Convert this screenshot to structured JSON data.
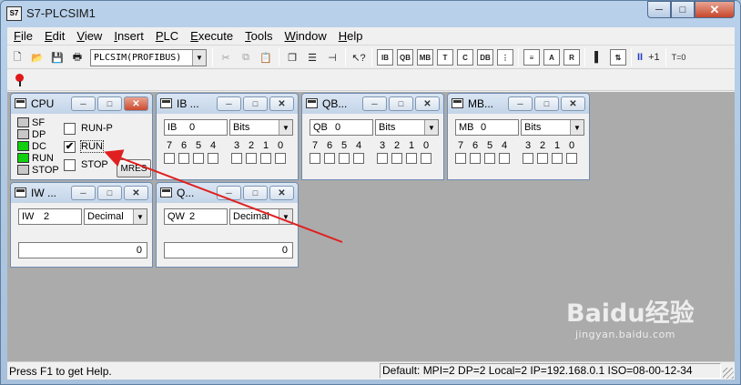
{
  "window": {
    "title": "S7-PLCSIM1",
    "icon_text": "S7"
  },
  "caption_buttons": {
    "minimize": "─",
    "maximize": "□",
    "close": "✕"
  },
  "menu": [
    {
      "label": "File",
      "key": "F",
      "rest": "ile"
    },
    {
      "label": "Edit",
      "key": "E",
      "rest": "dit"
    },
    {
      "label": "View",
      "key": "V",
      "rest": "iew"
    },
    {
      "label": "Insert",
      "key": "I",
      "rest": "nsert"
    },
    {
      "label": "PLC",
      "key": "P",
      "rest": "LC"
    },
    {
      "label": "Execute",
      "key": "E",
      "rest": "xecute"
    },
    {
      "label": "Tools",
      "key": "T",
      "rest": "ools"
    },
    {
      "label": "Window",
      "key": "W",
      "rest": "indow"
    },
    {
      "label": "Help",
      "key": "H",
      "rest": "elp"
    }
  ],
  "toolbar": {
    "interface_combo": "PLCSIM(PROFIBUS)",
    "plus_one": "+1",
    "t_zero": "T=0",
    "pause": "II"
  },
  "cpu": {
    "title": "CPU",
    "leds": [
      {
        "label": "SF",
        "on": false
      },
      {
        "label": "DP",
        "on": false
      },
      {
        "label": "DC",
        "on": true
      },
      {
        "label": "RUN",
        "on": true
      },
      {
        "label": "STOP",
        "on": false
      }
    ],
    "modes": [
      {
        "label": "RUN-P",
        "checked": false
      },
      {
        "label": "RUN",
        "checked": true
      },
      {
        "label": "STOP",
        "checked": false
      }
    ],
    "mres_label": "MRES",
    "check_mark": "✔"
  },
  "var_windows": [
    {
      "id": "ib",
      "title": "IB ...",
      "area": "IB",
      "address": "0",
      "format": "Bits",
      "bits": [
        "7",
        "6",
        "5",
        "4",
        "3",
        "2",
        "1",
        "0"
      ]
    },
    {
      "id": "qb",
      "title": "QB...",
      "area": "QB",
      "address": "0",
      "format": "Bits",
      "bits": [
        "7",
        "6",
        "5",
        "4",
        "3",
        "2",
        "1",
        "0"
      ]
    },
    {
      "id": "mb",
      "title": "MB...",
      "area": "MB",
      "address": "0",
      "format": "Bits",
      "bits": [
        "7",
        "6",
        "5",
        "4",
        "3",
        "2",
        "1",
        "0"
      ]
    },
    {
      "id": "iw",
      "title": "IW ...",
      "area": "IW",
      "address": "2",
      "format": "Decimal",
      "value": "0"
    },
    {
      "id": "qw",
      "title": "Q...",
      "area": "QW",
      "address": "2",
      "format": "Decimal",
      "value": "0"
    }
  ],
  "status": {
    "help": "Press F1 to get Help.",
    "connection": "Default:  MPI=2 DP=2 Local=2 IP=192.168.0.1 ISO=08-00-12-34"
  },
  "watermark": {
    "main": "Baidu经验",
    "sub": "jingyan.baidu.com"
  },
  "colors": {
    "led_on": "#10d010",
    "arrow": "#e02020",
    "mdi_background": "#ababab"
  }
}
